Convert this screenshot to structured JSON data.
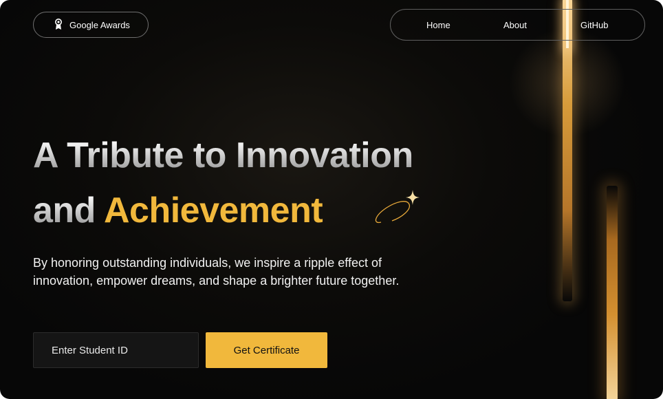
{
  "header": {
    "brand": {
      "label": "Google Awards",
      "icon": "award-trophy-icon"
    },
    "nav": [
      {
        "label": "Home"
      },
      {
        "label": "About"
      },
      {
        "label": "GitHub"
      }
    ]
  },
  "hero": {
    "title_line1": "A Tribute to Innovation",
    "title_line2_prefix": "and",
    "title_line2_accent": "Achievement",
    "decoration_icon": "sparkle-orbit-icon",
    "subtitle": "By honoring outstanding individuals, we inspire a ripple effect of innovation, empower dreams, and shape a brighter future together."
  },
  "form": {
    "student_id_placeholder": "Enter Student ID",
    "submit_label": "Get Certificate"
  },
  "colors": {
    "accent": "#f1b83c",
    "background": "#0a0a0a",
    "text": "#ffffff"
  }
}
